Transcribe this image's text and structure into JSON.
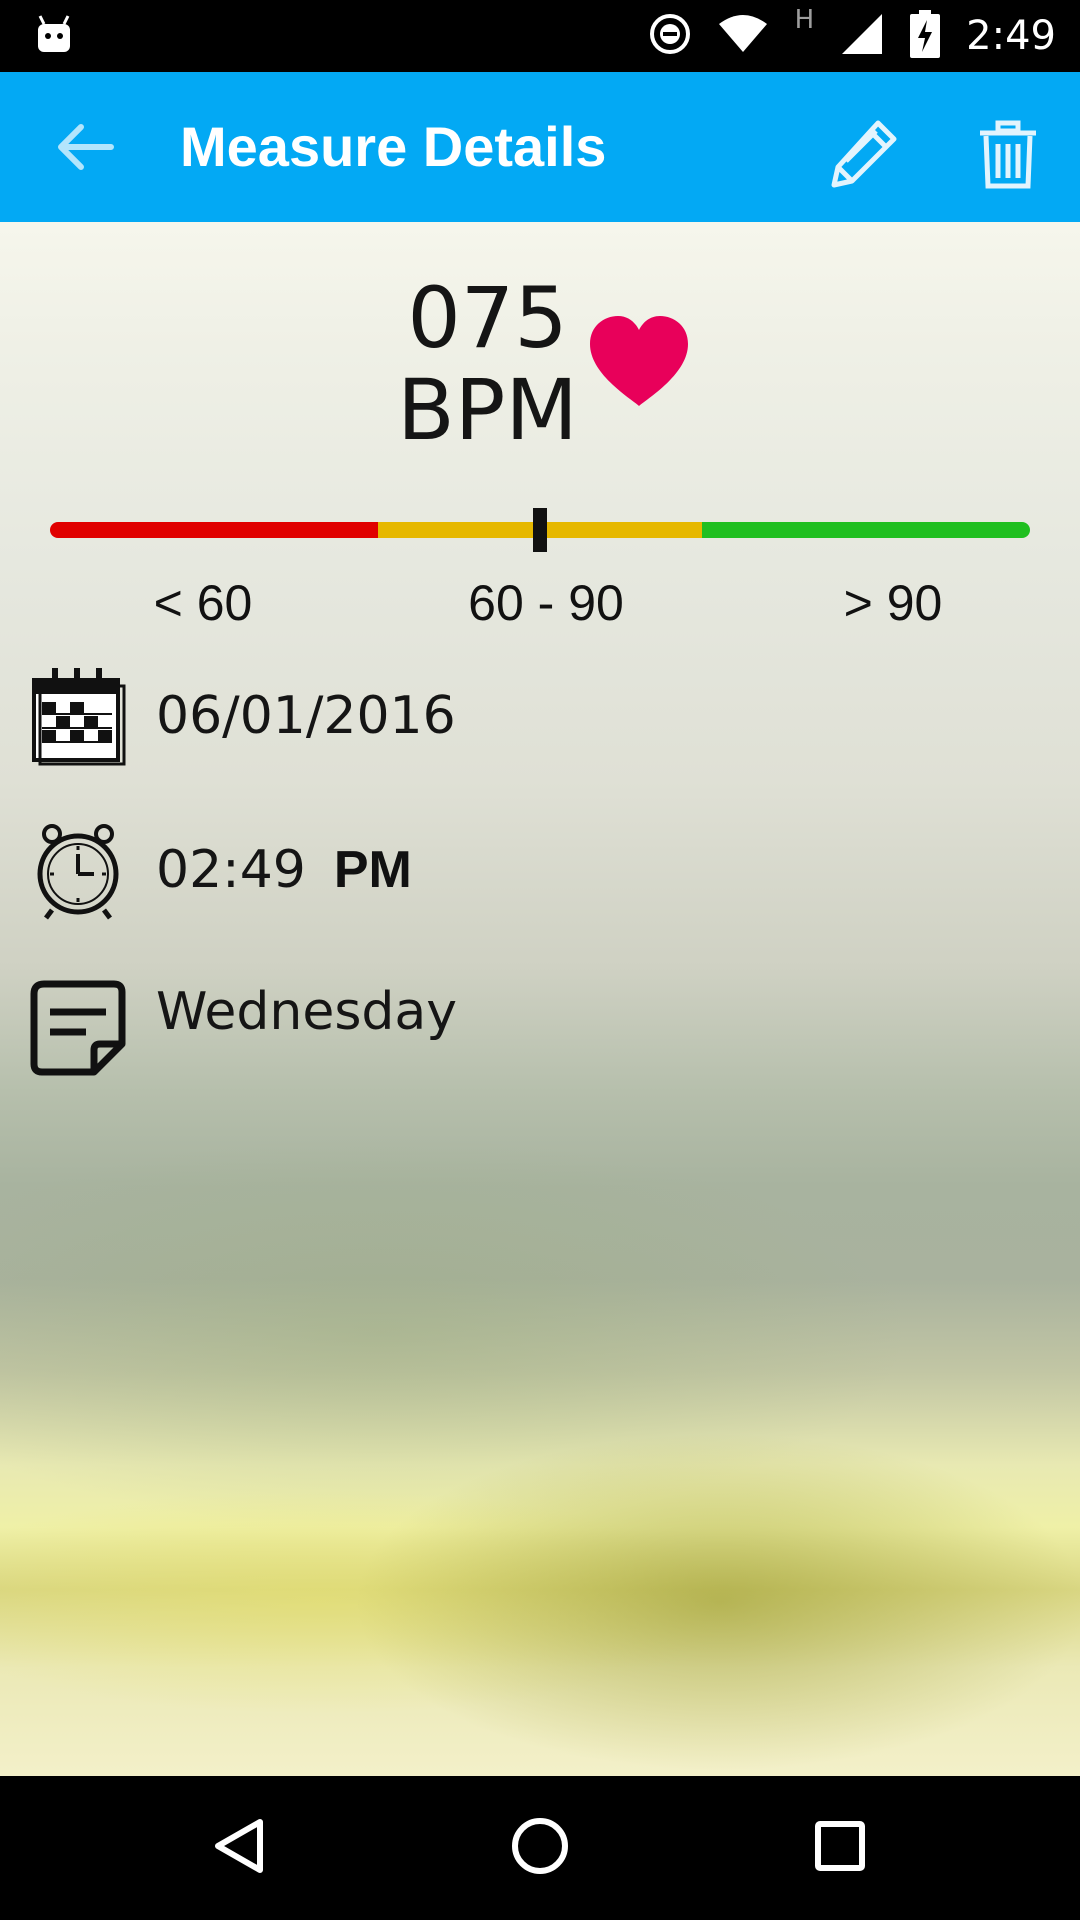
{
  "status_bar": {
    "time": "2:49",
    "network_label": "H",
    "icons": [
      "android-icon",
      "do-not-disturb-icon",
      "wifi-icon",
      "signal-icon",
      "battery-charging-icon"
    ]
  },
  "app_bar": {
    "title": "Measure Details",
    "background_color": "#03A9F4",
    "icons": [
      "back-arrow-icon",
      "pencil-icon",
      "trash-icon"
    ]
  },
  "measurement": {
    "value": "075",
    "unit": "BPM",
    "heart_color": "#E8005A",
    "scale": {
      "marker_value": 75,
      "segments": [
        {
          "label": "< 60",
          "color": "#E00000"
        },
        {
          "label": "60 - 90",
          "color": "#E6B800"
        },
        {
          "label": "> 90",
          "color": "#20BF20"
        }
      ]
    }
  },
  "details": {
    "date": "06/01/2016",
    "time": "02:49",
    "ampm": "PM",
    "note": "Wednesday",
    "icons": [
      "calendar-icon",
      "alarm-clock-icon",
      "note-icon"
    ]
  },
  "nav_bar": {
    "icons": [
      "nav-back-icon",
      "nav-home-icon",
      "nav-recents-icon"
    ]
  }
}
